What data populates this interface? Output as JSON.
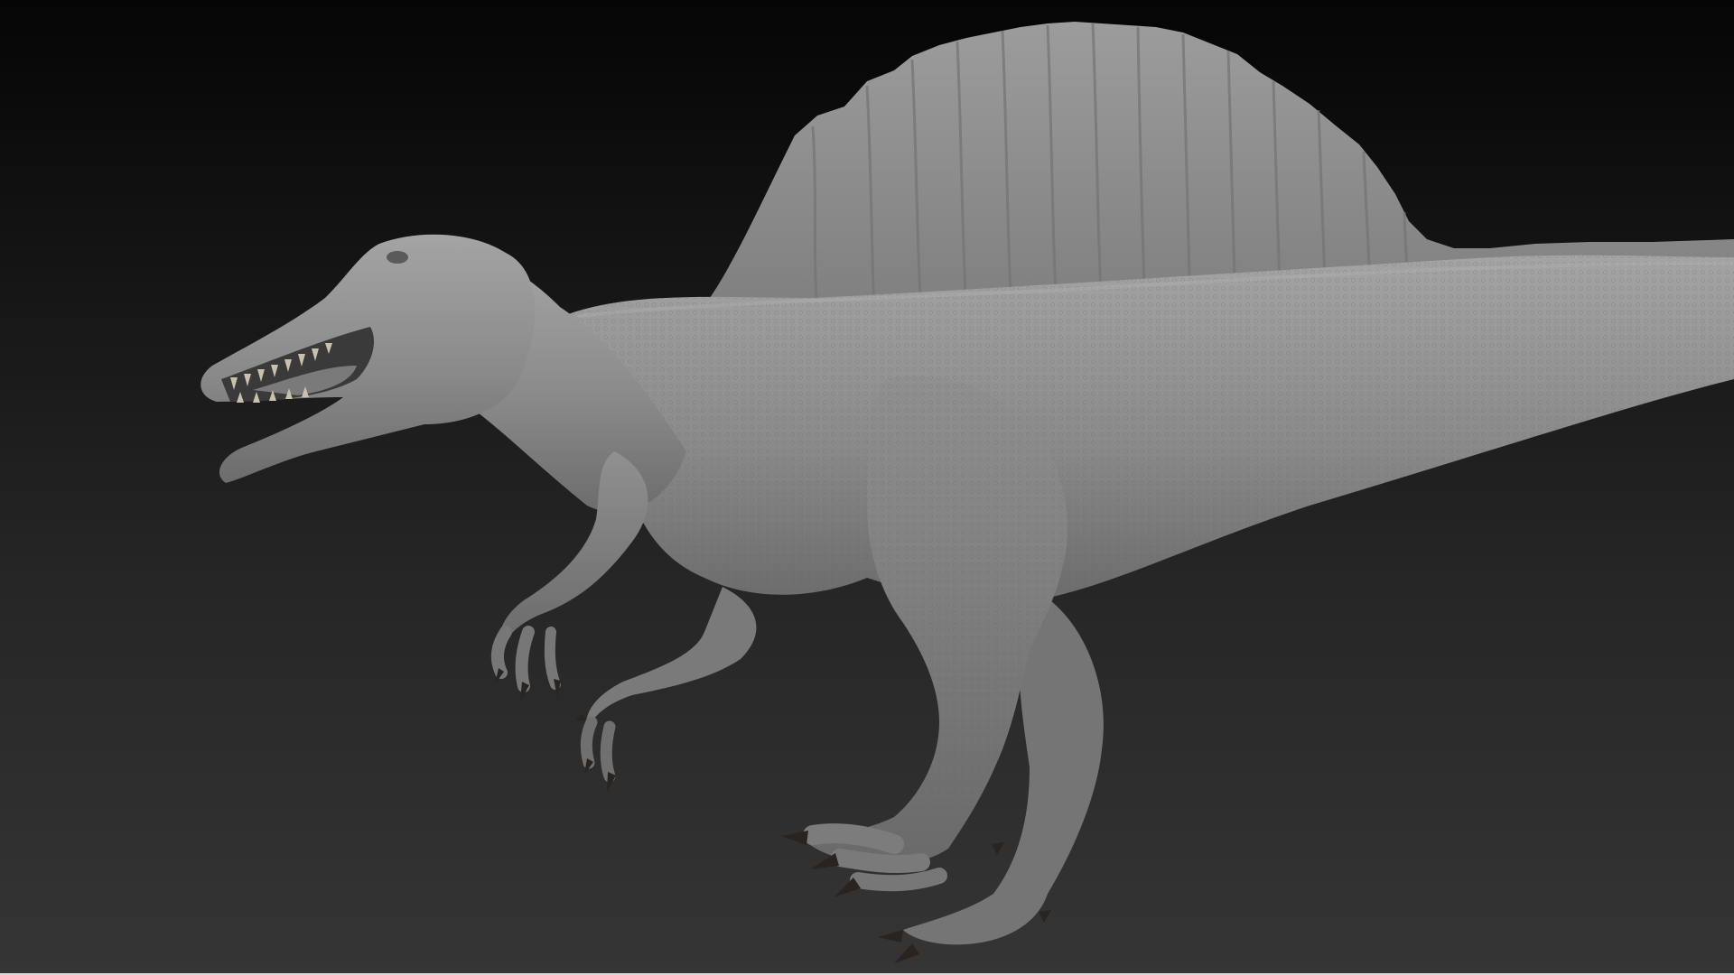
{
  "viewport": {
    "background_top": "#050505",
    "background_bottom": "#353535"
  },
  "model": {
    "subject": "spinosaurus-sculpt",
    "material_color": "#8e8e8e",
    "claw_color": "#2a2420"
  }
}
